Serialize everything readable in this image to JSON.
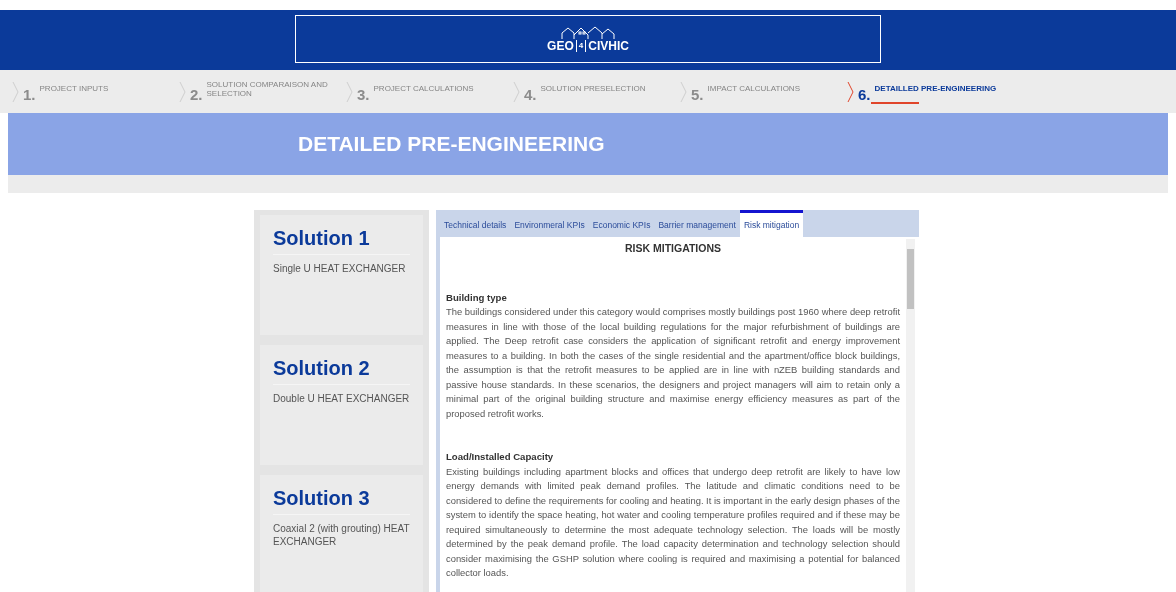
{
  "logo": {
    "left": "GEO",
    "middle": "4",
    "right": "CIVHIC"
  },
  "steps": [
    {
      "number": "1.",
      "label": "PROJECT INPUTS",
      "selected": false
    },
    {
      "number": "2.",
      "label": "SOLUTION COMPARAISON AND SELECTION",
      "selected": false
    },
    {
      "number": "3.",
      "label": "PROJECT CALCULATIONS",
      "selected": false
    },
    {
      "number": "4.",
      "label": "SOLUTION PRESELECTION",
      "selected": false
    },
    {
      "number": "5.",
      "label": "IMPACT CALCULATIONS",
      "selected": false
    },
    {
      "number": "6.",
      "label": "DETAILLED PRE-ENGINEERING",
      "selected": true
    }
  ],
  "page_title": "DETAILED PRE-ENGINEERING",
  "solutions": [
    {
      "title": "Solution 1",
      "description": "Single U HEAT EXCHANGER"
    },
    {
      "title": "Solution 2",
      "description": "Double U HEAT EXCHANGER"
    },
    {
      "title": "Solution 3",
      "description": "Coaxial 2 (with grouting) HEAT EXCHANGER"
    }
  ],
  "tabs": [
    {
      "label": "Technical details",
      "selected": false
    },
    {
      "label": "Environmeral KPIs",
      "selected": false
    },
    {
      "label": "Economic KPIs",
      "selected": false
    },
    {
      "label": "Barrier management",
      "selected": false
    },
    {
      "label": "Risk mitigation",
      "selected": true
    }
  ],
  "panel": {
    "heading": "RISK MITIGATIONS",
    "sections": [
      {
        "title": "Building type",
        "text": "The buildings considered under this category would comprises mostly buildings post 1960 where deep retrofit measures in line with those of the local building regulations for the major refurbishment of buildings are applied. The Deep retrofit case considers the application of significant retrofit and energy improvement measures to a building. In both the cases of the single residential and the apartment/office block buildings, the assumption is that the retrofit measures to be applied are in line with nZEB building standards and passive house standards. In these scenarios, the designers and project managers will aim to retain only a minimal part of the original building structure and maximise energy efficiency measures as part of the proposed retrofit works."
      },
      {
        "title": "Load/Installed Capacity",
        "text": "Existing buildings including apartment blocks and offices that undergo deep retrofit are likely to have low energy demands with limited peak demand profiles. The latitude and climatic conditions need to be considered to define the requirements for cooling and heating. It is important in the early design phases of the system to identify the space heating, hot water and cooling temperature profiles required and if these may be required simultaneously to determine the most adequate technology selection. The loads will be mostly determined by the peak demand profile. The load capacity determination and technology selection should consider maximising the GSHP solution where cooling is required and maximising a potential for balanced collector loads."
      }
    ]
  }
}
